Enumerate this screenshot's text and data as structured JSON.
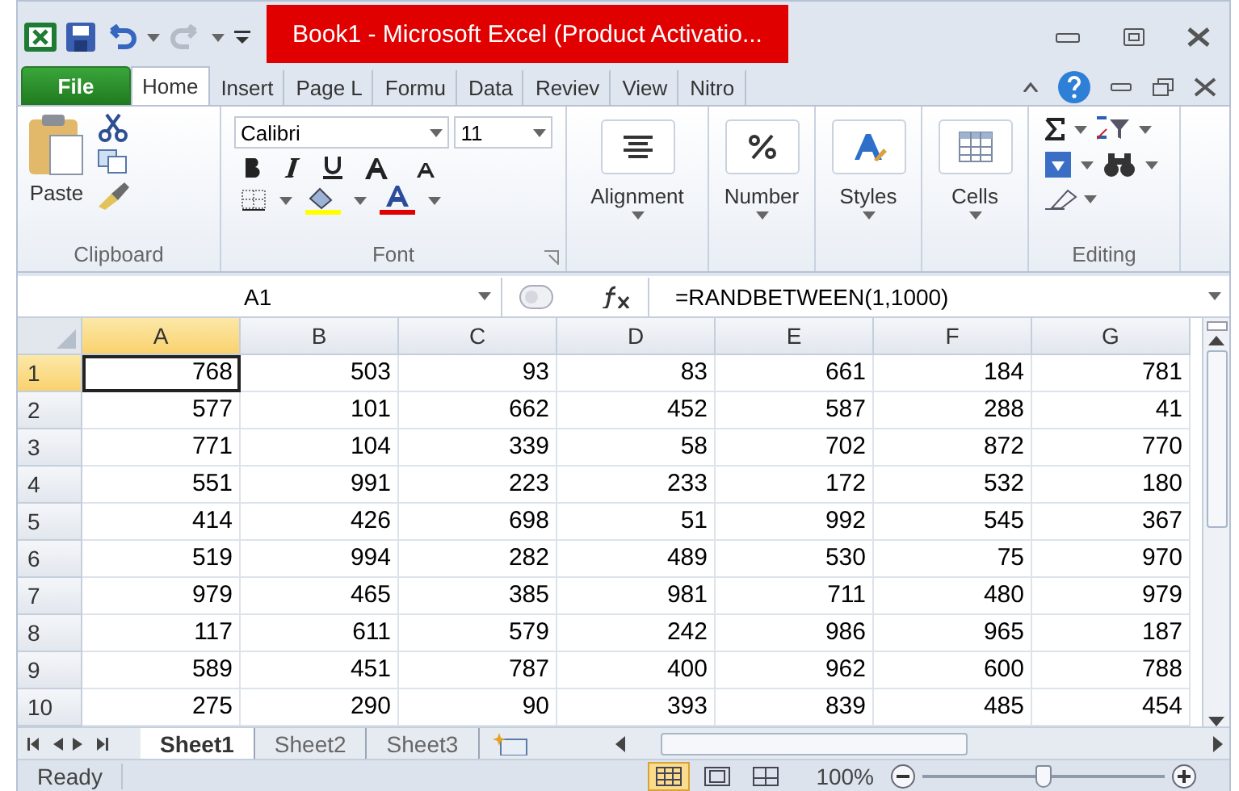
{
  "window": {
    "title": "Book1  -  Microsoft Excel (Product Activatio..."
  },
  "ribbon_tabs": [
    {
      "label": "File",
      "kind": "file",
      "selected": false
    },
    {
      "label": "Home",
      "kind": "tab",
      "selected": true
    },
    {
      "label": "Insert",
      "kind": "tab",
      "selected": false
    },
    {
      "label": "Page L",
      "kind": "tab",
      "selected": false
    },
    {
      "label": "Formu",
      "kind": "tab",
      "selected": false
    },
    {
      "label": "Data",
      "kind": "tab",
      "selected": false
    },
    {
      "label": "Reviev",
      "kind": "tab",
      "selected": false
    },
    {
      "label": "View",
      "kind": "tab",
      "selected": false
    },
    {
      "label": "Nitro",
      "kind": "tab",
      "selected": false
    }
  ],
  "ribbon": {
    "clipboard": {
      "paste": "Paste",
      "label": "Clipboard"
    },
    "font": {
      "name": "Calibri",
      "size": "11",
      "label": "Font"
    },
    "big_buttons": [
      {
        "label": "Alignment",
        "kind": "align"
      },
      {
        "label": "Number",
        "kind": "number"
      },
      {
        "label": "Styles",
        "kind": "styles"
      },
      {
        "label": "Cells",
        "kind": "cells"
      }
    ],
    "editing": {
      "label": "Editing"
    }
  },
  "formula_bar": {
    "name_box": "A1",
    "formula": "=RANDBETWEEN(1,1000)"
  },
  "sheet": {
    "columns": [
      {
        "label": "A",
        "selected": true
      },
      {
        "label": "B",
        "selected": false
      },
      {
        "label": "C",
        "selected": false
      },
      {
        "label": "D",
        "selected": false
      },
      {
        "label": "E",
        "selected": false
      },
      {
        "label": "F",
        "selected": false
      },
      {
        "label": "G",
        "selected": false
      }
    ],
    "rows": [
      {
        "header": "1",
        "selected": true,
        "cells": [
          "768",
          "503",
          "93",
          "83",
          "661",
          "184",
          "781"
        ]
      },
      {
        "header": "2",
        "selected": false,
        "cells": [
          "577",
          "101",
          "662",
          "452",
          "587",
          "288",
          "41"
        ]
      },
      {
        "header": "3",
        "selected": false,
        "cells": [
          "771",
          "104",
          "339",
          "58",
          "702",
          "872",
          "770"
        ]
      },
      {
        "header": "4",
        "selected": false,
        "cells": [
          "551",
          "991",
          "223",
          "233",
          "172",
          "532",
          "180"
        ]
      },
      {
        "header": "5",
        "selected": false,
        "cells": [
          "414",
          "426",
          "698",
          "51",
          "992",
          "545",
          "367"
        ]
      },
      {
        "header": "6",
        "selected": false,
        "cells": [
          "519",
          "994",
          "282",
          "489",
          "530",
          "75",
          "970"
        ]
      },
      {
        "header": "7",
        "selected": false,
        "cells": [
          "979",
          "465",
          "385",
          "981",
          "711",
          "480",
          "979"
        ]
      },
      {
        "header": "8",
        "selected": false,
        "cells": [
          "117",
          "611",
          "579",
          "242",
          "986",
          "965",
          "187"
        ]
      },
      {
        "header": "9",
        "selected": false,
        "cells": [
          "589",
          "451",
          "787",
          "400",
          "962",
          "600",
          "788"
        ]
      },
      {
        "header": "10",
        "selected": false,
        "cells": [
          "275",
          "290",
          "90",
          "393",
          "839",
          "485",
          "454"
        ]
      }
    ]
  },
  "sheet_tabs": [
    {
      "label": "Sheet1",
      "selected": true
    },
    {
      "label": "Sheet2",
      "selected": false
    },
    {
      "label": "Sheet3",
      "selected": false
    }
  ],
  "status_bar": {
    "status": "Ready",
    "views": [
      {
        "kind": "normal",
        "selected": true
      },
      {
        "kind": "layout",
        "selected": false
      },
      {
        "kind": "break",
        "selected": false
      }
    ],
    "zoom": "100%",
    "zoom_level": {
      "level": 0.5
    }
  }
}
